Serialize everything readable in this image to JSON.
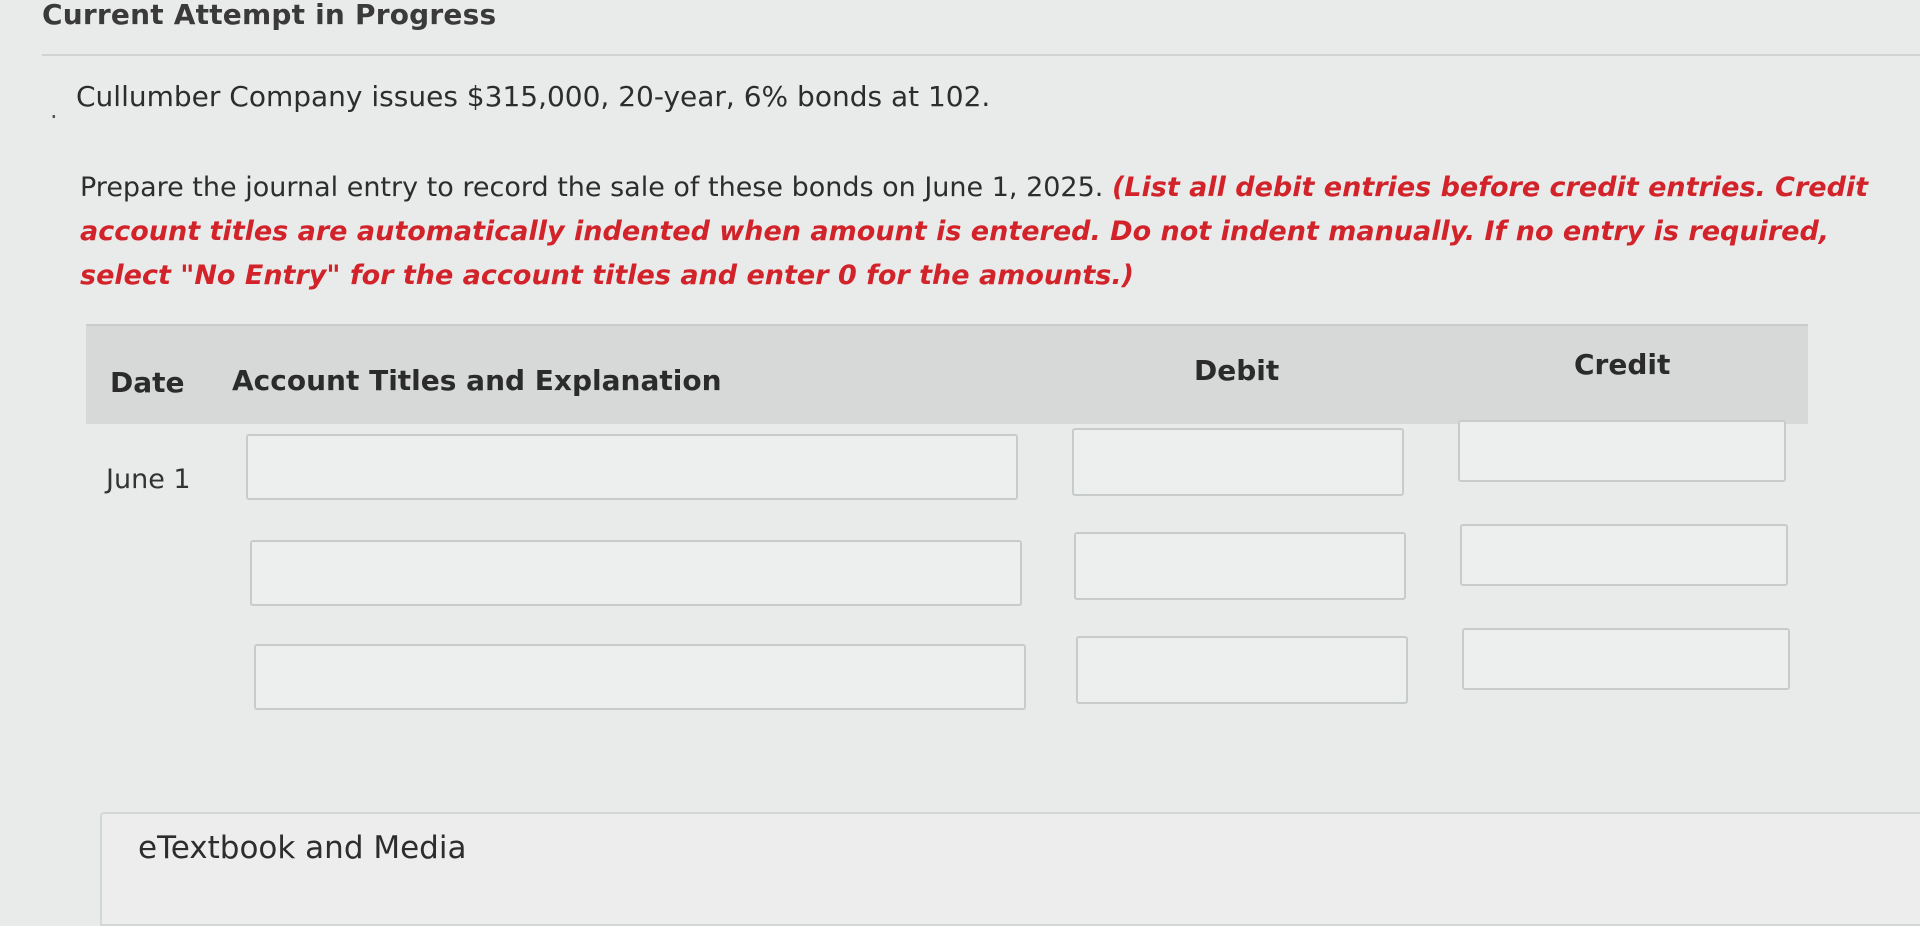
{
  "header": {
    "title": "Current Attempt in Progress"
  },
  "question": {
    "bullet": ".",
    "problem": "Cullumber Company issues $315,000, 20-year, 6% bonds at 102.",
    "instruction": "Prepare the journal entry to record the sale of these bonds on June 1, 2025.",
    "note": "(List all debit entries before credit entries. Credit account titles are automatically indented when amount is entered. Do not indent manually. If no entry is required, select \"No Entry\" for the account titles and enter 0 for the amounts.)"
  },
  "table": {
    "headers": {
      "date": "Date",
      "account": "Account Titles and Explanation",
      "debit": "Debit",
      "credit": "Credit"
    },
    "date": "June 1",
    "rows": [
      {
        "account": "",
        "debit": "",
        "credit": ""
      },
      {
        "account": "",
        "debit": "",
        "credit": ""
      },
      {
        "account": "",
        "debit": "",
        "credit": ""
      }
    ]
  },
  "footer": {
    "etextbook_label": "eTextbook and Media"
  }
}
